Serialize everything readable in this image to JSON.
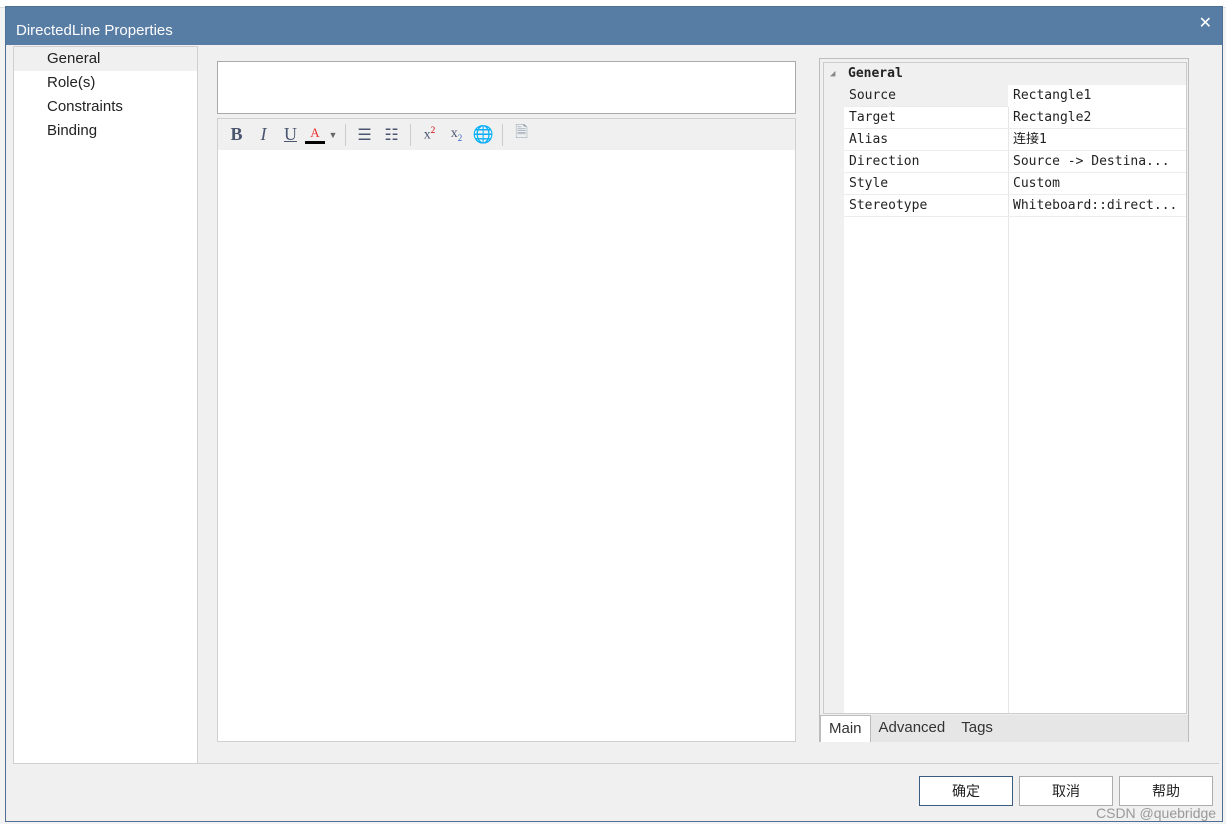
{
  "window": {
    "title": "DirectedLine Properties",
    "close_icon": "close-icon"
  },
  "tree": {
    "items": [
      "General",
      "Role(s)",
      "Constraints",
      "Binding"
    ],
    "selected": 0
  },
  "name_input": {
    "value": ""
  },
  "toolbar": {
    "bold": "B",
    "italic": "I",
    "underline": "U"
  },
  "properties": {
    "category": "General",
    "rows": [
      {
        "key": "Source",
        "value": "Rectangle1"
      },
      {
        "key": "Target",
        "value": "Rectangle2"
      },
      {
        "key": "Alias",
        "value": "连接1"
      },
      {
        "key": "Direction",
        "value": "Source -> Destina..."
      },
      {
        "key": "Style",
        "value": "Custom"
      },
      {
        "key": "Stereotype",
        "value": "Whiteboard::direct..."
      }
    ],
    "tabs": [
      "Main",
      "Advanced",
      "Tags"
    ],
    "active_tab": 0
  },
  "buttons": {
    "ok": "确定",
    "cancel": "取消",
    "help": "帮助"
  },
  "watermark": "CSDN @quebridge",
  "colors": {
    "title_bar": "#577da5"
  }
}
